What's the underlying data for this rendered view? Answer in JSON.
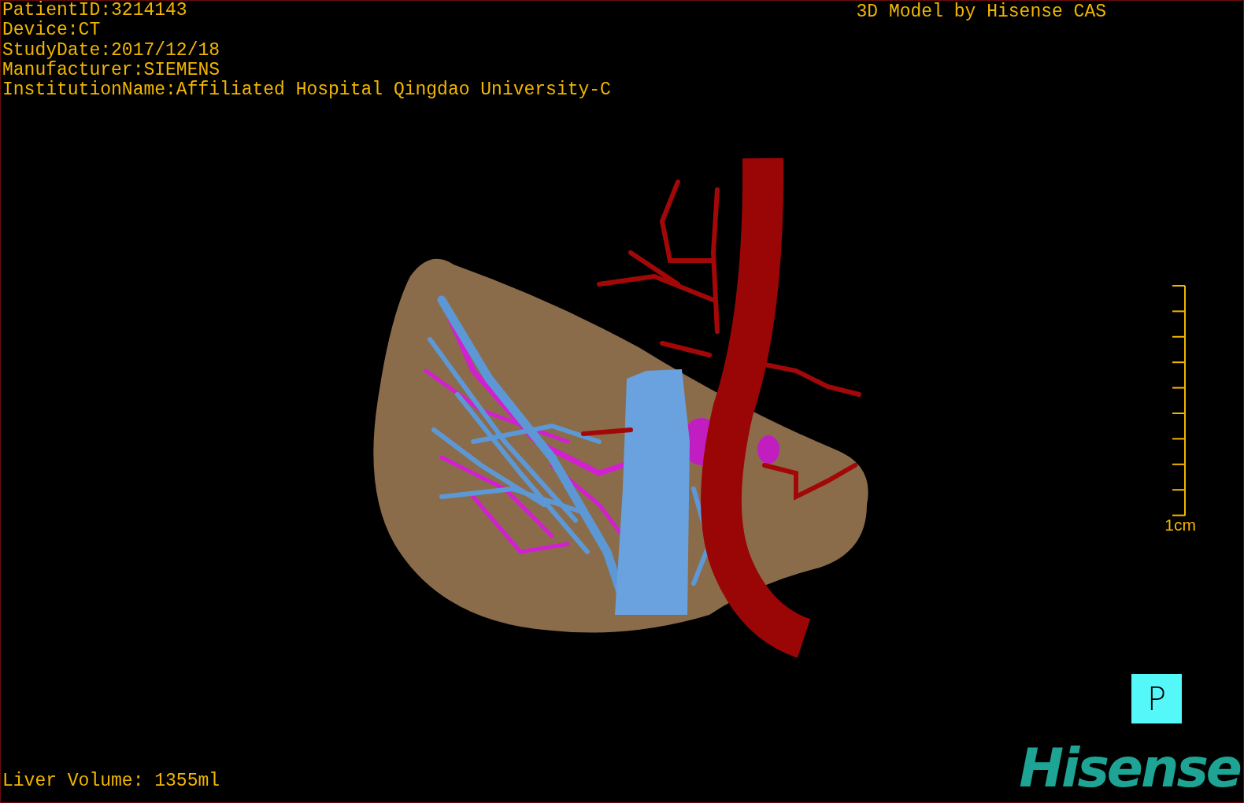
{
  "info_lines": [
    "PatientID:3214143",
    "Device:CT",
    "StudyDate:2017/12/18",
    "Manufacturer:SIEMENS",
    "InstitutionName:Affiliated Hospital Qingdao University-C"
  ],
  "title": "3D Model by Hisense CAS",
  "scale": {
    "label": "1cm"
  },
  "orientation_button": {
    "label": "P"
  },
  "logo": {
    "text": "Hisense"
  },
  "volume": "Liver Volume: 1355ml"
}
